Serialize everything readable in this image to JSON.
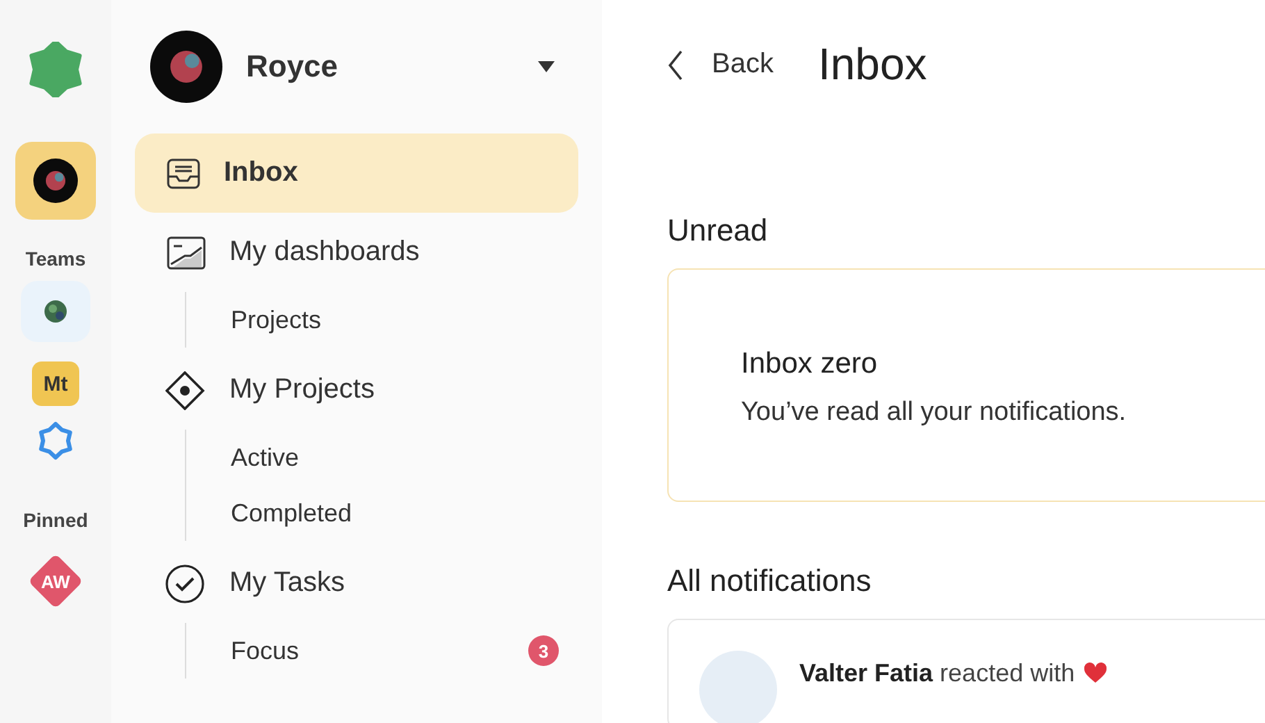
{
  "rail": {
    "workspace": {
      "selected": true
    },
    "sections": [
      {
        "label": "Teams",
        "items": [
          {
            "kind": "avatar",
            "selected": false
          },
          {
            "kind": "initials",
            "text": "Mt",
            "selected": false
          },
          {
            "kind": "star",
            "selected": false
          }
        ]
      },
      {
        "label": "Pinned",
        "items": [
          {
            "kind": "diamond",
            "text": "AW",
            "selected": false
          }
        ]
      }
    ]
  },
  "sidebar": {
    "workspace_name": "Royce",
    "items": [
      {
        "label": "Inbox",
        "selected": true
      },
      {
        "label": "My dashboards",
        "selected": false,
        "children": [
          {
            "label": "Projects",
            "selected": false
          }
        ]
      },
      {
        "label": "My Projects",
        "selected": false,
        "children": [
          {
            "label": "Active",
            "selected": false
          },
          {
            "label": "Completed",
            "selected": false
          }
        ]
      },
      {
        "label": "My Tasks",
        "selected": false,
        "children": [
          {
            "label": "Focus",
            "selected": false,
            "badge": "3"
          }
        ]
      }
    ]
  },
  "header": {
    "back": "Back",
    "title": "Inbox"
  },
  "unread": {
    "heading": "Unread",
    "empty_title": "Inbox zero",
    "empty_text": "You’ve read all your notifications."
  },
  "all": {
    "heading": "All notifications",
    "items": [
      {
        "text": "**Valter Fatia** reacted with"
      }
    ]
  }
}
